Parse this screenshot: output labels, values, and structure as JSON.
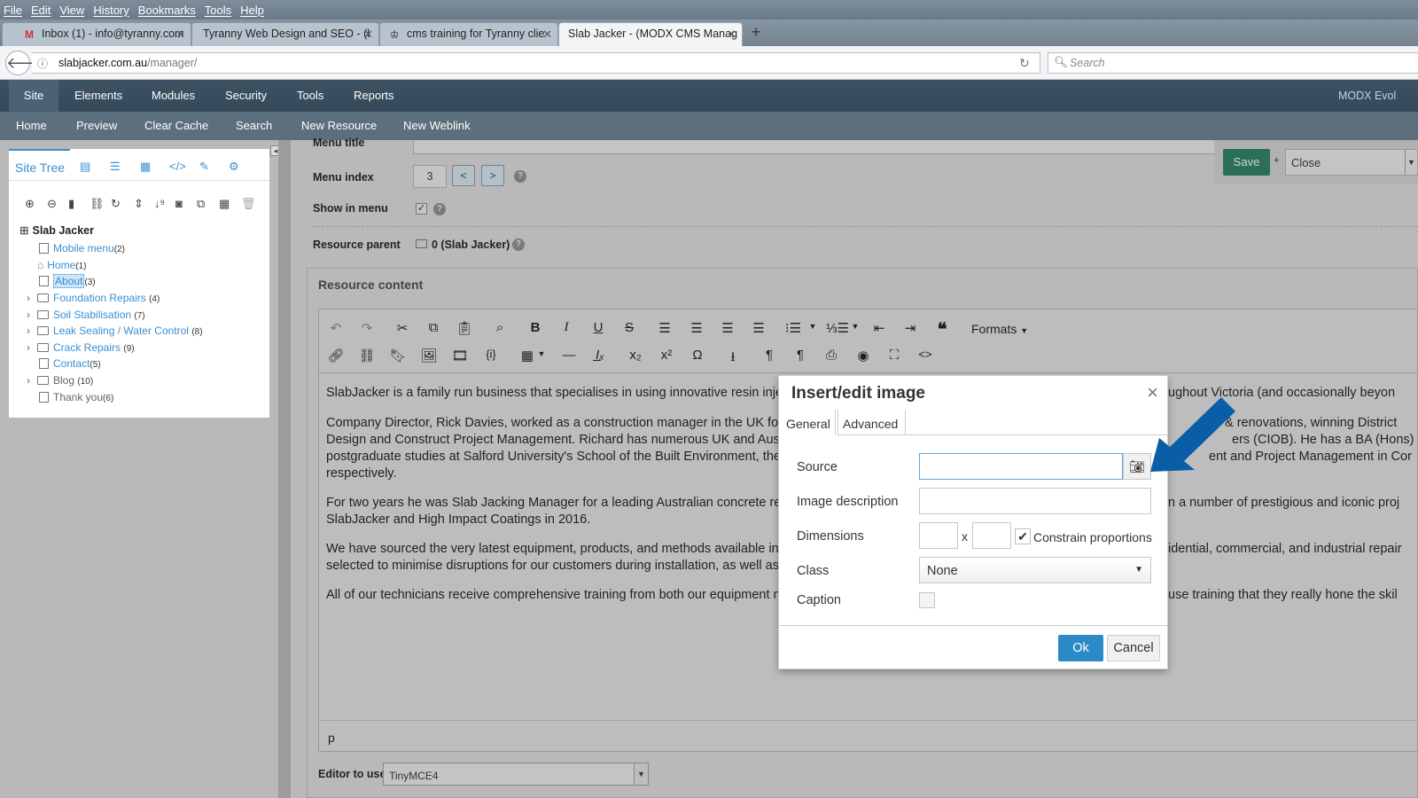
{
  "browser": {
    "menu": [
      "File",
      "Edit",
      "View",
      "History",
      "Bookmarks",
      "Tools",
      "Help"
    ],
    "tabs": [
      {
        "label": "Inbox (1) - info@tyranny.com",
        "icon": "gmail-icon"
      },
      {
        "label": "Tyranny Web Design and SEO - (l",
        "icon": ""
      },
      {
        "label": "cms training for Tyranny clie",
        "icon": "crown-icon"
      },
      {
        "label": "Slab Jacker - (MODX CMS Manag",
        "icon": ""
      }
    ],
    "url_host": "slabjacker.com.au",
    "url_path": "/manager/",
    "search_placeholder": "Search"
  },
  "modx": {
    "topnav": [
      "Site",
      "Elements",
      "Modules",
      "Security",
      "Tools",
      "Reports"
    ],
    "brand": "MODX Evol",
    "subnav": [
      "Home",
      "Preview",
      "Clear Cache",
      "Search",
      "New Resource",
      "New Weblink"
    ]
  },
  "tree": {
    "tab_label": "Site Tree",
    "root": "Slab Jacker",
    "nodes": [
      {
        "label": "Mobile menu",
        "count": "(2)"
      },
      {
        "label": "Home",
        "count": "(1)"
      },
      {
        "label": "About",
        "count": "(3)"
      },
      {
        "label": "Foundation Repairs",
        "count": "(4)"
      },
      {
        "label": "Soil Stabilisation",
        "count": "(7)"
      },
      {
        "label": "Leak Sealing / Water Control",
        "count": "(8)"
      },
      {
        "label": "Crack Repairs",
        "count": "(9)"
      },
      {
        "label": "Contact",
        "count": "(5)"
      },
      {
        "label": "Blog",
        "count": "(10)"
      },
      {
        "label": "Thank you",
        "count": "(6)"
      }
    ]
  },
  "form": {
    "menu_title_label": "Menu title",
    "menu_index_label": "Menu index",
    "menu_index_value": "3",
    "prev_btn": "<",
    "next_btn": ">",
    "show_in_menu_label": "Show in menu",
    "resource_parent_label": "Resource parent",
    "resource_parent_value": "0 (Slab Jacker)",
    "save_label": "Save",
    "close_label": "Close",
    "resource_content_label": "Resource content",
    "formats_label": "Formats",
    "editor_paragraphs": [
      "SlabJacker is a family run business that specialises in using innovative resin injectic",
      "Company Director, Rick Davies, worked as a construction manager in the UK for ov",
      "Design and Construct Project Management. Richard has numerous UK and Austral",
      "postgraduate studies at Salford University's School of the Built Environment, the UK",
      "respectively.",
      "For two years he was Slab Jacking Manager for a leading Australian concrete repa",
      "SlabJacker and High Impact Coatings in 2016.",
      "We have sourced the very latest equipment, products, and methods available inter",
      "selected to minimise disruptions for our customers during installation, as well as be",
      "All of our technicians receive comprehensive training from both our equipment man"
    ],
    "editor_right": [
      "ughout Victoria (and occasionally beyon",
      "& renovations, winning District",
      "ers (CIOB). He has a BA (Hons) i",
      "ent and Project Management in Cor",
      "n a number of prestigious and iconic proj",
      "idential, commercial, and industrial repair",
      "use training that they really hone the skil"
    ],
    "status_path": "p",
    "editor_to_use_label": "Editor to use",
    "editor_to_use_value": "TinyMCE4"
  },
  "dialog": {
    "title": "Insert/edit image",
    "tabs": [
      "General",
      "Advanced"
    ],
    "source_label": "Source",
    "source_value": "",
    "description_label": "Image description",
    "dimensions_label": "Dimensions",
    "dim_separator": "x",
    "constrain_label": "Constrain proportions",
    "class_label": "Class",
    "class_value": "None",
    "caption_label": "Caption",
    "ok_label": "Ok",
    "cancel_label": "Cancel"
  },
  "colors": {
    "accent": "#2d8ac7",
    "arrow": "#0a5ea8",
    "save": "#2b6f5a"
  }
}
